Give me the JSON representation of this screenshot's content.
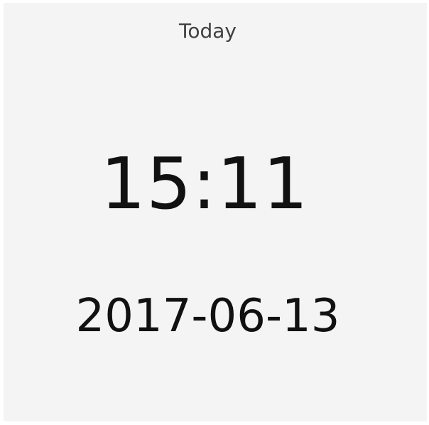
{
  "widget": {
    "title": "Today",
    "time": "15:11",
    "date": "2017-06-13"
  }
}
